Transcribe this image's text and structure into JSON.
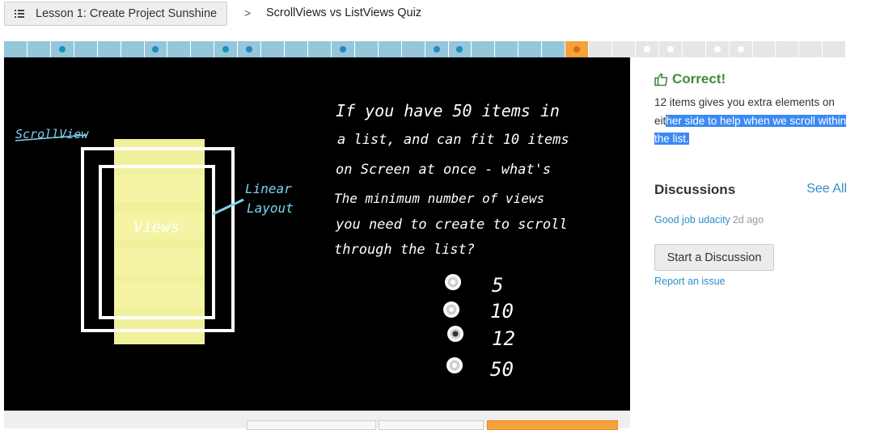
{
  "header": {
    "lesson_button_label": "Lesson 1: Create Project Sunshine",
    "separator": ">",
    "page_title": "ScrollViews vs ListViews Quiz"
  },
  "progress": {
    "segments": [
      {
        "state": "done",
        "dot": false
      },
      {
        "state": "done",
        "dot": false
      },
      {
        "state": "done",
        "dot": true
      },
      {
        "state": "done",
        "dot": false
      },
      {
        "state": "done",
        "dot": false
      },
      {
        "state": "done",
        "dot": false
      },
      {
        "state": "done",
        "dot": true
      },
      {
        "state": "done",
        "dot": false
      },
      {
        "state": "done",
        "dot": false
      },
      {
        "state": "done",
        "dot": true
      },
      {
        "state": "done",
        "dot": true
      },
      {
        "state": "done",
        "dot": false
      },
      {
        "state": "done",
        "dot": false
      },
      {
        "state": "done",
        "dot": false
      },
      {
        "state": "done",
        "dot": true
      },
      {
        "state": "done",
        "dot": false
      },
      {
        "state": "done",
        "dot": false
      },
      {
        "state": "done",
        "dot": false
      },
      {
        "state": "done",
        "dot": true
      },
      {
        "state": "done",
        "dot": true
      },
      {
        "state": "done",
        "dot": false
      },
      {
        "state": "done",
        "dot": false
      },
      {
        "state": "done",
        "dot": false
      },
      {
        "state": "done",
        "dot": false
      },
      {
        "state": "current",
        "dot": true
      },
      {
        "state": "todo",
        "dot": false
      },
      {
        "state": "todo",
        "dot": false
      },
      {
        "state": "todo",
        "dot": true
      },
      {
        "state": "todo",
        "dot": true
      },
      {
        "state": "todo",
        "dot": false
      },
      {
        "state": "todo",
        "dot": true
      },
      {
        "state": "todo",
        "dot": true
      },
      {
        "state": "todo",
        "dot": false
      },
      {
        "state": "todo",
        "dot": false
      },
      {
        "state": "todo",
        "dot": false
      },
      {
        "state": "todo",
        "dot": false
      }
    ],
    "colors": {
      "done": "#95c6da",
      "current": "#f5a13c",
      "todo": "#e6e6e6"
    }
  },
  "video": {
    "scrollview_label": "ScrollView",
    "linear_layout_label": [
      "Linear",
      "Layout"
    ],
    "views_label": "Views",
    "question_lines": [
      "If you have 50 items in",
      "a list, and can fit 10 items",
      "on Screen at once - what's",
      "The minimum number of views",
      "you need to create to scroll",
      "through the list?"
    ],
    "options": [
      "5",
      "10",
      "12",
      "50"
    ]
  },
  "feedback": {
    "title": "Correct!",
    "explanation_plain": "12 items gives you extra elements on eit",
    "explanation_highlight": "her side to help when we scroll within the list.",
    "accent_color": "#3f8b3a"
  },
  "discussions": {
    "title": "Discussions",
    "see_all": "See All",
    "items": [
      {
        "text": "Good job udacity",
        "time": "2d ago"
      }
    ],
    "start_button": "Start a Discussion",
    "report_link": "Report an issue"
  }
}
